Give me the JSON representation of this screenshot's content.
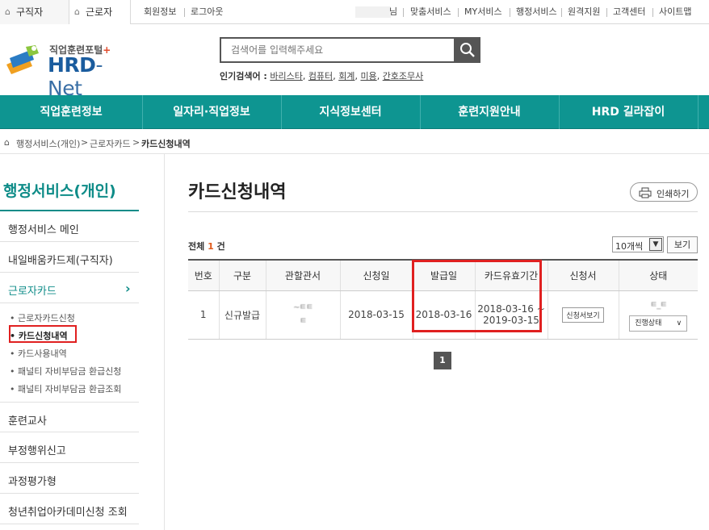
{
  "topbar": {
    "tab_jobseeker": "구직자",
    "tab_worker": "근로자",
    "member_info": "회원정보",
    "logout": "로그아웃",
    "name_suffix": "님",
    "links": [
      "맞춤서비스",
      "MY서비스",
      "행정서비스",
      "원격지원",
      "고객센터",
      "사이트맵"
    ]
  },
  "logo": {
    "sub": "직업훈련포털",
    "plus": "+",
    "main_hrd": "HRD",
    "main_net": "-Net"
  },
  "search": {
    "placeholder": "검색어를 입력해주세요",
    "popular_label": "인기검색어 :",
    "keywords": [
      "바리스타",
      "컴퓨터",
      "회계",
      "미용",
      "간호조무사"
    ]
  },
  "gnb": [
    "직업훈련정보",
    "일자리·직업정보",
    "지식정보센터",
    "훈련지원안내",
    "HRD 길라잡이"
  ],
  "breadcrumb": [
    "행정서비스(개인)",
    "근로자카드",
    "카드신청내역"
  ],
  "sidebar": {
    "title": "행정서비스(개인)",
    "items": [
      "행정서비스 메인",
      "내일배움카드제(구직자)",
      "근로자카드"
    ],
    "sub_items": [
      "근로자카드신청",
      "카드신청내역",
      "카드사용내역",
      "패널티 자비부담금 환급신청",
      "패널티 자비부담금 환급조회"
    ],
    "bottom_items": [
      "훈련교사",
      "부정행위신고",
      "과정평가형",
      "청년취업아카데미신청 조회"
    ]
  },
  "content": {
    "title": "카드신청내역",
    "print_label": "인쇄하기",
    "total_label": "전체",
    "total_count": "1",
    "total_unit": "건",
    "per_page": "10개씩",
    "view_label": "보기",
    "headers": [
      "번호",
      "구분",
      "관할관서",
      "신청일",
      "발급일",
      "카드유효기간",
      "신청서",
      "상태"
    ],
    "row": {
      "no": "1",
      "type": "신규발급",
      "office_line1": "~ㅌㅌ",
      "office_line2": "ㅌ",
      "apply_date": "2018-03-15",
      "issue_date": "2018-03-16",
      "valid_from": "2018-03-16 ~",
      "valid_to": "2019-03-15",
      "form_btn": "신청서보기",
      "status_text": "ㅌ_ㅌ",
      "status_select": "진행상태"
    },
    "page": "1"
  }
}
